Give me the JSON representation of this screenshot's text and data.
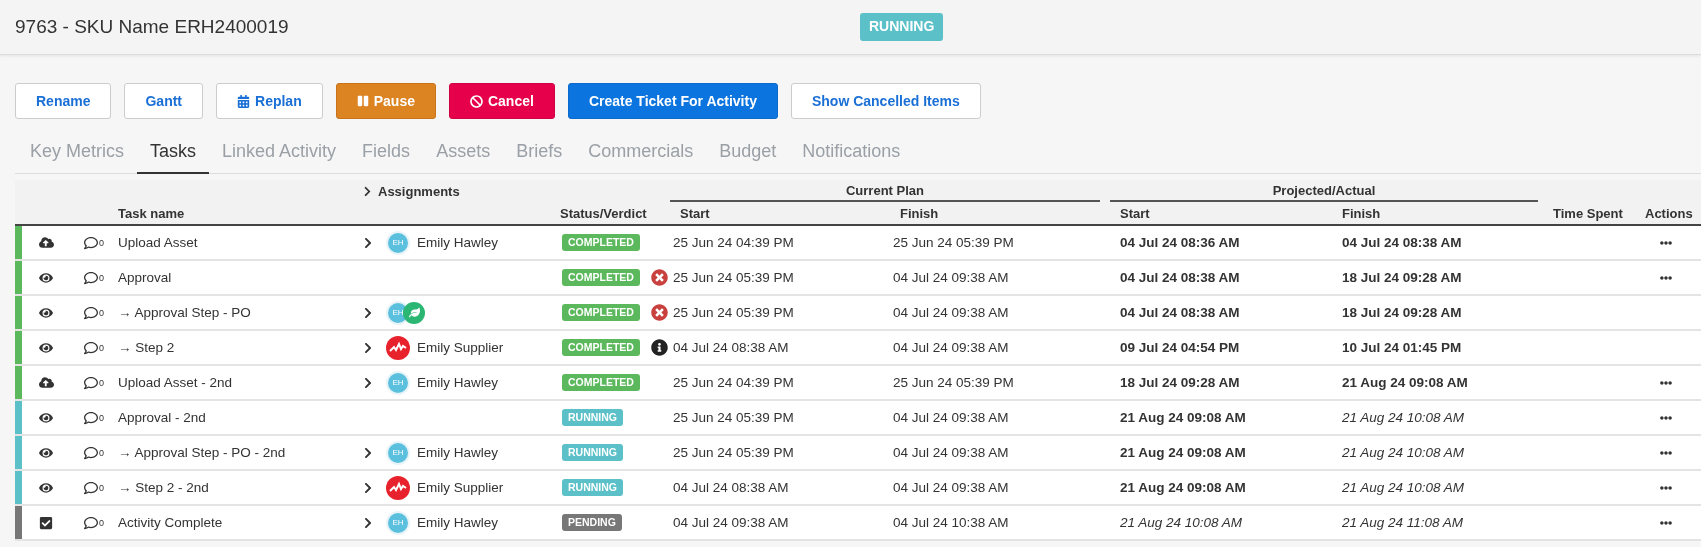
{
  "header": {
    "title": "9763 - SKU Name ERH2400019",
    "status": {
      "label": "RUNNING",
      "kind": "running"
    }
  },
  "buttons": [
    {
      "label": "Rename",
      "kind": "plain"
    },
    {
      "label": "Gantt",
      "kind": "plain"
    },
    {
      "label": "Replan",
      "kind": "calendar"
    },
    {
      "label": "Pause",
      "kind": "pause"
    },
    {
      "label": "Cancel",
      "kind": "cancel"
    },
    {
      "label": "Create Ticket For Activity",
      "kind": "primary"
    },
    {
      "label": "Show Cancelled Items",
      "kind": "plain"
    }
  ],
  "tabs": [
    {
      "label": "Key Metrics",
      "selected": false
    },
    {
      "label": "Tasks",
      "selected": true
    },
    {
      "label": "Linked Activity",
      "selected": false
    },
    {
      "label": "Fields",
      "selected": false
    },
    {
      "label": "Assets",
      "selected": false
    },
    {
      "label": "Briefs",
      "selected": false
    },
    {
      "label": "Commercials",
      "selected": false
    },
    {
      "label": "Budget",
      "selected": false
    },
    {
      "label": "Notifications",
      "selected": false
    }
  ],
  "table": {
    "groups": {
      "current": "Current Plan",
      "projected": "Projected/Actual"
    },
    "columns": {
      "task": "Task name",
      "assignments": "Assignments",
      "status": "Status/Verdict",
      "plan_start": "Start",
      "plan_finish": "Finish",
      "actual_start": "Start",
      "actual_finish": "Finish",
      "time_spent": "Time Spent",
      "actions": "Actions"
    },
    "rows": [
      {
        "kind": "upload",
        "comments": "0",
        "name": "Upload Asset",
        "expandable": true,
        "assignee": {
          "kind": "initials",
          "initials": "EH",
          "name": "Emily Hawley"
        },
        "status": {
          "label": "COMPLETED",
          "kind": "completed"
        },
        "plan_start": "25 Jun 24 04:39 PM",
        "plan_finish": "25 Jun 24 05:39 PM",
        "actual_start": {
          "text": "04 Jul 24 08:36 AM",
          "bold": true,
          "italic": false
        },
        "actual_finish": {
          "text": "04 Jul 24 08:38 AM",
          "bold": true,
          "italic": false
        },
        "actions": true
      },
      {
        "kind": "view",
        "comments": "0",
        "name": "Approval",
        "expandable": false,
        "status": {
          "label": "COMPLETED",
          "kind": "completed"
        },
        "verdict": {
          "kind": "rejected"
        },
        "plan_start": "25 Jun 24 05:39 PM",
        "plan_finish": "04 Jul 24 09:38 AM",
        "actual_start": {
          "text": "04 Jul 24 08:38 AM",
          "bold": true,
          "italic": false
        },
        "actual_finish": {
          "text": "18 Jul 24 09:28 AM",
          "bold": true,
          "italic": false
        },
        "actions": true
      },
      {
        "kind": "view",
        "comments": "0",
        "name": "→ Approval Step - PO",
        "expandable": true,
        "assignee": {
          "kind": "group",
          "initials": "EH"
        },
        "status": {
          "label": "COMPLETED",
          "kind": "completed"
        },
        "verdict": {
          "kind": "rejected"
        },
        "plan_start": "25 Jun 24 05:39 PM",
        "plan_finish": "04 Jul 24 09:38 AM",
        "actual_start": {
          "text": "04 Jul 24 08:38 AM",
          "bold": true,
          "italic": false
        },
        "actual_finish": {
          "text": "18 Jul 24 09:28 AM",
          "bold": true,
          "italic": false
        },
        "actions": false
      },
      {
        "kind": "view",
        "comments": "0",
        "name": "→ Step 2",
        "expandable": true,
        "assignee": {
          "kind": "supplier",
          "name": "Emily Supplier"
        },
        "status": {
          "label": "COMPLETED",
          "kind": "completed"
        },
        "verdict": {
          "kind": "info"
        },
        "plan_start": "04 Jul 24 08:38 AM",
        "plan_finish": "04 Jul 24 09:38 AM",
        "actual_start": {
          "text": "09 Jul 24 04:54 PM",
          "bold": true,
          "italic": false
        },
        "actual_finish": {
          "text": "10 Jul 24 01:45 PM",
          "bold": true,
          "italic": false
        },
        "actions": false
      },
      {
        "kind": "upload",
        "comments": "0",
        "name": "Upload Asset - 2nd",
        "expandable": true,
        "assignee": {
          "kind": "initials",
          "initials": "EH",
          "name": "Emily Hawley"
        },
        "status": {
          "label": "COMPLETED",
          "kind": "completed"
        },
        "plan_start": "25 Jun 24 04:39 PM",
        "plan_finish": "25 Jun 24 05:39 PM",
        "actual_start": {
          "text": "18 Jul 24 09:28 AM",
          "bold": true,
          "italic": false
        },
        "actual_finish": {
          "text": "21 Aug 24 09:08 AM",
          "bold": true,
          "italic": false
        },
        "actions": true
      },
      {
        "kind": "view",
        "comments": "0",
        "name": "Approval - 2nd",
        "expandable": false,
        "status": {
          "label": "RUNNING",
          "kind": "running"
        },
        "plan_start": "25 Jun 24 05:39 PM",
        "plan_finish": "04 Jul 24 09:38 AM",
        "actual_start": {
          "text": "21 Aug 24 09:08 AM",
          "bold": true,
          "italic": false
        },
        "actual_finish": {
          "text": "21 Aug 24 10:08 AM",
          "bold": false,
          "italic": true
        },
        "actions": true
      },
      {
        "kind": "view",
        "comments": "0",
        "name": "→ Approval Step - PO - 2nd",
        "expandable": true,
        "assignee": {
          "kind": "initials",
          "initials": "EH",
          "name": "Emily Hawley"
        },
        "status": {
          "label": "RUNNING",
          "kind": "running"
        },
        "plan_start": "25 Jun 24 05:39 PM",
        "plan_finish": "04 Jul 24 09:38 AM",
        "actual_start": {
          "text": "21 Aug 24 09:08 AM",
          "bold": true,
          "italic": false
        },
        "actual_finish": {
          "text": "21 Aug 24 10:08 AM",
          "bold": false,
          "italic": true
        },
        "actions": true
      },
      {
        "kind": "view",
        "comments": "0",
        "name": "→ Step 2 - 2nd",
        "expandable": true,
        "assignee": {
          "kind": "supplier",
          "name": "Emily Supplier"
        },
        "status": {
          "label": "RUNNING",
          "kind": "running"
        },
        "plan_start": "04 Jul 24 08:38 AM",
        "plan_finish": "04 Jul 24 09:38 AM",
        "actual_start": {
          "text": "21 Aug 24 09:08 AM",
          "bold": true,
          "italic": false
        },
        "actual_finish": {
          "text": "21 Aug 24 10:08 AM",
          "bold": false,
          "italic": true
        },
        "actions": true
      },
      {
        "kind": "complete",
        "comments": "0",
        "name": "Activity Complete",
        "expandable": true,
        "assignee": {
          "kind": "initials",
          "initials": "EH",
          "name": "Emily Hawley"
        },
        "status": {
          "label": "PENDING",
          "kind": "pending"
        },
        "plan_start": "04 Jul 24 09:38 AM",
        "plan_finish": "04 Jul 24 10:38 AM",
        "actual_start": {
          "text": "21 Aug 24 10:08 AM",
          "bold": false,
          "italic": true
        },
        "actual_finish": {
          "text": "21 Aug 24 11:08 AM",
          "bold": false,
          "italic": true
        },
        "actions": true
      }
    ]
  }
}
